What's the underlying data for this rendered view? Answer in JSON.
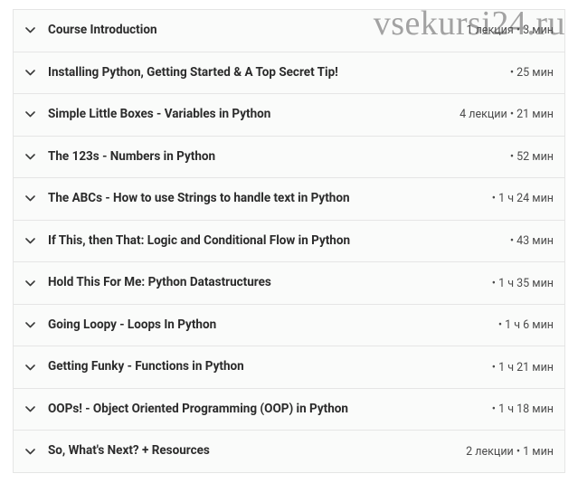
{
  "watermark": "vsekursi24.ru",
  "sections": [
    {
      "title": "Course Introduction",
      "meta": "1 лекция • 3 мин"
    },
    {
      "title": "Installing Python, Getting Started & A Top Secret Tip!",
      "meta": "• 25 мин"
    },
    {
      "title": "Simple Little Boxes - Variables in Python",
      "meta": "4 лекции • 21 мин"
    },
    {
      "title": "The 123s - Numbers in Python",
      "meta": "• 52 мин"
    },
    {
      "title": "The ABCs - How to use Strings to handle text in Python",
      "meta": "• 1 ч 24 мин"
    },
    {
      "title": "If This, then That: Logic and Conditional Flow in Python",
      "meta": "• 43 мин"
    },
    {
      "title": "Hold This For Me: Python Datastructures",
      "meta": "• 1 ч 35 мин"
    },
    {
      "title": "Going Loopy - Loops In Python",
      "meta": "• 1 ч 6 мин"
    },
    {
      "title": "Getting Funky - Functions in Python",
      "meta": "• 1 ч 21 мин"
    },
    {
      "title": "OOPs! - Object Oriented Programming (OOP) in Python",
      "meta": "• 1 ч 18 мин"
    },
    {
      "title": "So, What's Next? + Resources",
      "meta": "2 лекции • 1 мин"
    }
  ]
}
